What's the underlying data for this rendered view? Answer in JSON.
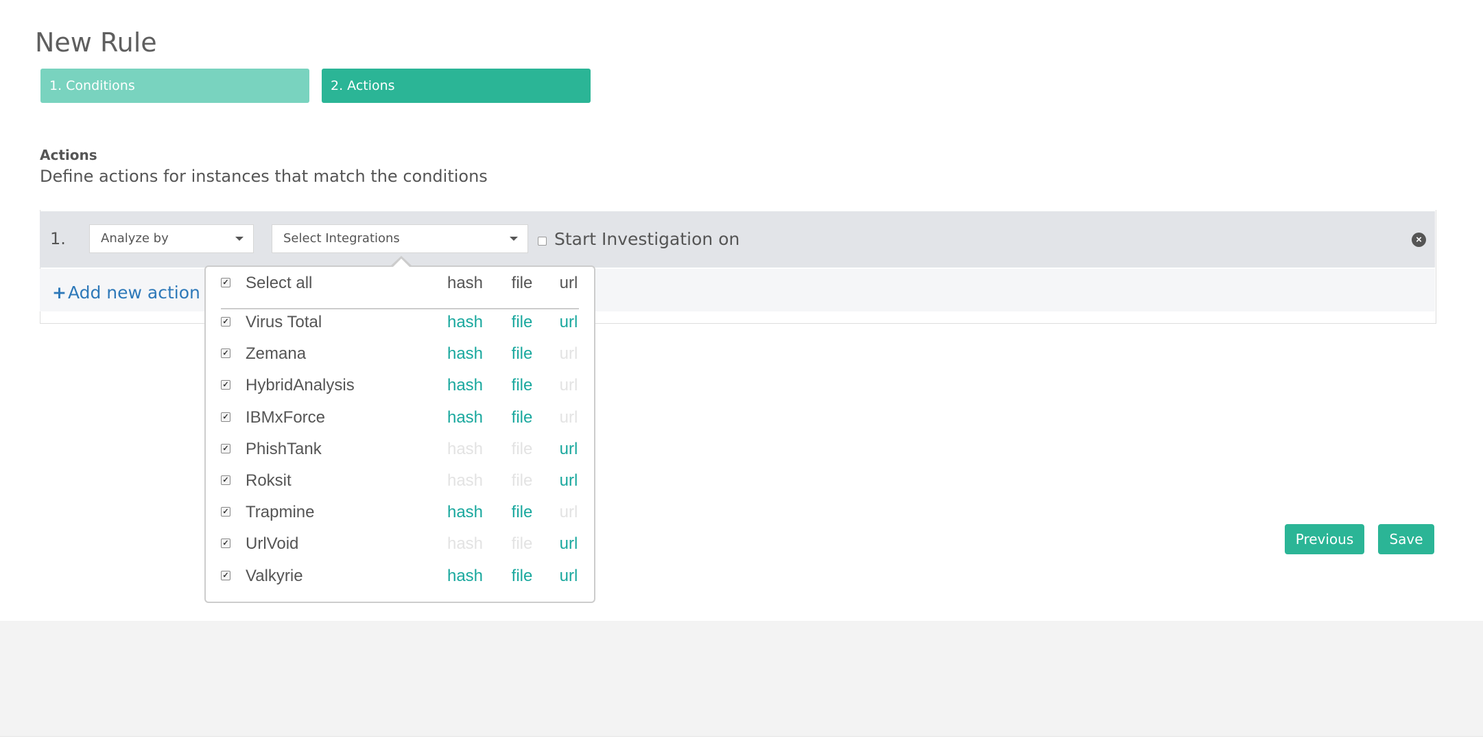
{
  "page": {
    "title": "New Rule"
  },
  "steps": {
    "conditions_label": "1. Conditions",
    "actions_label": "2. Actions"
  },
  "actions_section": {
    "heading": "Actions",
    "description": "Define actions for instances that match the conditions"
  },
  "action_row": {
    "number": "1.",
    "analyze_select": "Analyze by",
    "integrations_select": "Select Integrations",
    "start_investigation_label": "Start Investigation on",
    "start_investigation_checked": false,
    "remove_icon": "close-circle-icon"
  },
  "add_action": {
    "label": "Add new action",
    "icon": "plus-icon"
  },
  "buttons": {
    "previous": "Previous",
    "save": "Save"
  },
  "dropdown": {
    "select_all_label": "Select all",
    "select_all_checked": true,
    "headers": {
      "hash": "hash",
      "file": "file",
      "url": "url"
    },
    "items": [
      {
        "name": "Virus Total",
        "checked": true,
        "hash": true,
        "file": true,
        "url": true
      },
      {
        "name": "Zemana",
        "checked": true,
        "hash": true,
        "file": true,
        "url": false
      },
      {
        "name": "HybridAnalysis",
        "checked": true,
        "hash": true,
        "file": true,
        "url": false
      },
      {
        "name": "IBMxForce",
        "checked": true,
        "hash": true,
        "file": true,
        "url": false
      },
      {
        "name": "PhishTank",
        "checked": true,
        "hash": false,
        "file": false,
        "url": true
      },
      {
        "name": "Roksit",
        "checked": true,
        "hash": false,
        "file": false,
        "url": true
      },
      {
        "name": "Trapmine",
        "checked": true,
        "hash": true,
        "file": true,
        "url": false
      },
      {
        "name": "UrlVoid",
        "checked": true,
        "hash": false,
        "file": false,
        "url": true
      },
      {
        "name": "Valkyrie",
        "checked": true,
        "hash": true,
        "file": true,
        "url": true
      }
    ]
  },
  "colors": {
    "accent": "#2bb596",
    "accent_light": "#79d3bf",
    "capability_on": "#1aa89e",
    "capability_off": "#e3e3e3",
    "link": "#2e79b9"
  }
}
